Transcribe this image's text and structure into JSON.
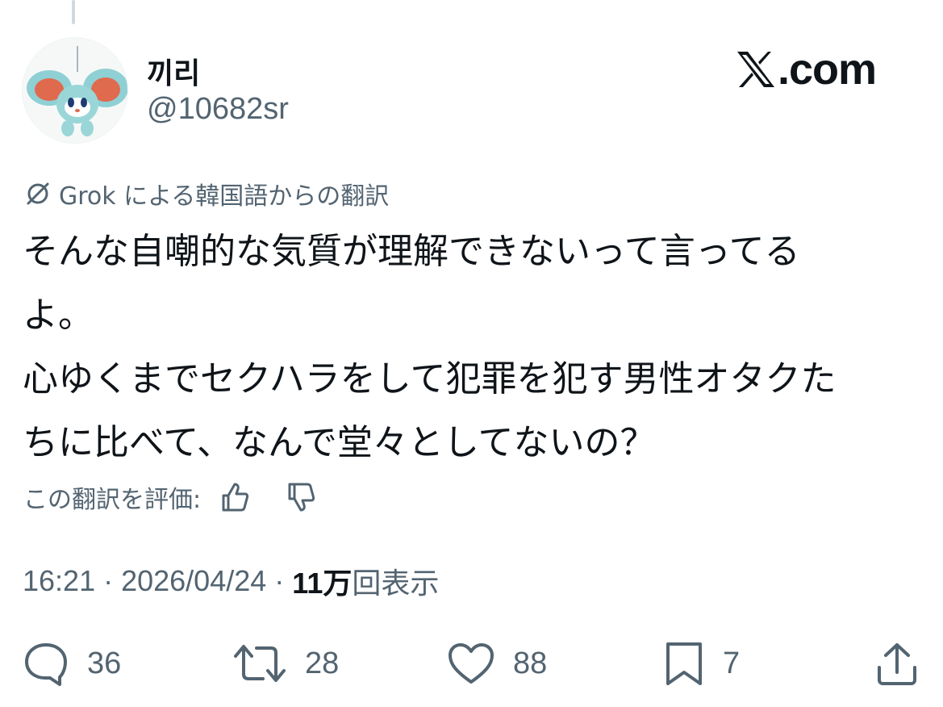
{
  "author": {
    "display_name": "끼리",
    "handle": "@10682sr",
    "avatar_icon": "plush-toy-avatar"
  },
  "brand": {
    "logo_icon": "x-logo-icon",
    "text": ".com"
  },
  "translation": {
    "icon": "translate-slash-icon",
    "note": "Grok による韓国語からの翻訳"
  },
  "tweet": {
    "text": "そんな自嘲的な気質が理解できないって言ってる\nよ。\n心ゆくまでセクハラをして犯罪を犯す男性オタクた\nちに比べて、なんで堂々としてないの？"
  },
  "rating": {
    "label": "この翻訳を評価:",
    "like_icon": "thumbs-up-icon",
    "dislike_icon": "thumbs-down-icon"
  },
  "meta": {
    "time": "16:21",
    "date": "2026/04/24",
    "views_count": "11万",
    "views_label": "回表示",
    "separator": "·"
  },
  "actions": {
    "replies": "36",
    "reposts": "28",
    "likes": "88",
    "bookmarks": "7"
  },
  "colors": {
    "text": "#0f1419",
    "secondary": "#536471",
    "thread_line": "#cfd9de"
  }
}
